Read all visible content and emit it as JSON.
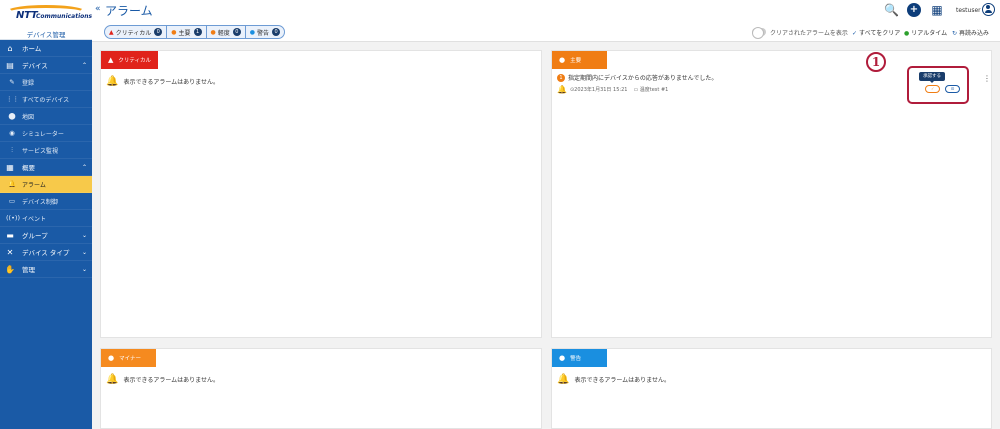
{
  "brand": {
    "logo_main": "NTT",
    "logo_sub": "Communications",
    "app_name": "デバイス管理"
  },
  "sidebar": {
    "items": [
      {
        "label": "ホーム",
        "type": "section",
        "icon": "home-icon",
        "glyph": "⌂"
      },
      {
        "label": "デバイス",
        "type": "section",
        "icon": "device-icon",
        "glyph": "▤",
        "chevron": "⌃"
      },
      {
        "label": "登録",
        "type": "sub",
        "icon": "register-icon",
        "glyph": "✎"
      },
      {
        "label": "すべてのデバイス",
        "type": "sub",
        "icon": "all-devices-icon",
        "glyph": "⋮⋮"
      },
      {
        "label": "地図",
        "type": "sub",
        "icon": "map-pin-icon",
        "glyph": "⬤"
      },
      {
        "label": "シミュレーター",
        "type": "sub",
        "icon": "simulator-icon",
        "glyph": "◉"
      },
      {
        "label": "サービス監視",
        "type": "sub",
        "icon": "service-monitor-icon",
        "glyph": "⫶"
      },
      {
        "label": "概要",
        "type": "section",
        "icon": "overview-icon",
        "glyph": "▦",
        "chevron": "⌃"
      },
      {
        "label": "アラーム",
        "type": "sub",
        "icon": "bell-icon",
        "glyph": "🔔",
        "active": true
      },
      {
        "label": "デバイス制御",
        "type": "sub",
        "icon": "device-control-icon",
        "glyph": "▭"
      },
      {
        "label": "イベント",
        "type": "sub",
        "icon": "event-icon",
        "glyph": "((•))"
      },
      {
        "label": "グループ",
        "type": "section",
        "icon": "folder-icon",
        "glyph": "▬",
        "chevron": "⌄"
      },
      {
        "label": "デバイス タイプ",
        "type": "section",
        "icon": "device-type-icon",
        "glyph": "✕",
        "chevron": "⌄"
      },
      {
        "label": "管理",
        "type": "section",
        "icon": "handshake-icon",
        "glyph": "✋",
        "chevron": "⌄"
      }
    ]
  },
  "header": {
    "back": "«",
    "title": "アラーム",
    "user": "testuser",
    "search_glyph": "🔍",
    "plus_glyph": "+",
    "apps_glyph": "▦"
  },
  "toolbar": {
    "filters": [
      {
        "label": "クリティカル",
        "count": "0",
        "glyph": "▲",
        "color": "#e0231b"
      },
      {
        "label": "主要",
        "count": "1",
        "glyph": "●",
        "color": "#f07d14"
      },
      {
        "label": "軽度",
        "count": "0",
        "glyph": "●",
        "color": "#f07d14"
      },
      {
        "label": "警告",
        "count": "0",
        "glyph": "●",
        "color": "#1a8fe0"
      }
    ],
    "show_cleared": "クリアされたアラームを表示",
    "clear_all": "すべてをクリア",
    "realtime": "リアルタイム",
    "reload": "再読み込み"
  },
  "panels": {
    "critical": {
      "label": "クリティカル",
      "color": "#e0231b",
      "empty": "表示できるアラームはありません。"
    },
    "major": {
      "label": "主要",
      "color": "#f07d14",
      "alarm": {
        "text": "指定期間内にデバイスからの応答がありませんでした。",
        "count": "1",
        "time": "⊙2023年1月31日 15:21",
        "device": "▭ 温度test #1"
      },
      "tooltip": "承認する",
      "ack_glyph": "🗸",
      "clear_glyph": "⊙",
      "more": "⋮"
    },
    "minor": {
      "label": "マイナー",
      "color": "#f07d14",
      "empty": "表示できるアラームはありません。"
    },
    "warning": {
      "label": "警告",
      "color": "#1a8fe0",
      "empty": "表示できるアラームはありません。"
    }
  },
  "annotation": {
    "marker": "1"
  }
}
